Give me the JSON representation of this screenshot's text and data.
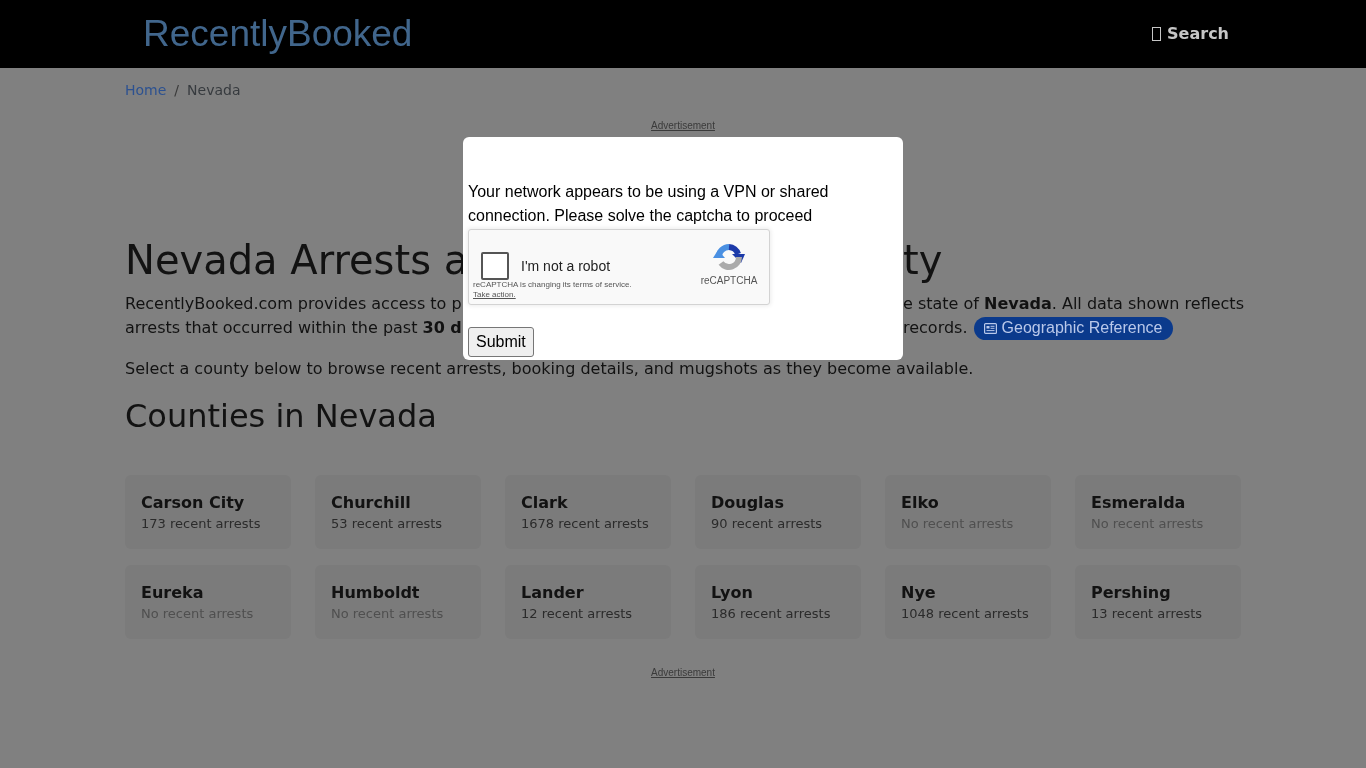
{
  "header": {
    "logo": "RecentlyBooked",
    "search_link": {
      "label": "Search"
    }
  },
  "breadcrumb": {
    "separator": "/",
    "items": [
      {
        "label": "Home",
        "current": false
      },
      {
        "label": "Nevada",
        "current": true
      }
    ]
  },
  "top_ad": {
    "label": "Advertisement"
  },
  "intro": {
    "heading": {
      "left": "Nevada Arrests a",
      "right": "ty"
    },
    "lines": [
      {
        "left": "RecentlyBooked.com provides access to p",
        "right": "e state of **Nevada**. All data shown reflects"
      },
      {
        "left": "arrests that occurred within the past **30 d**",
        "right": "records.",
        "badge": {
          "label": "Geographic Reference"
        }
      }
    ],
    "note": "Select a county below to browse recent arrests, booking details, and mugshots as they become available."
  },
  "counties_heading": "Counties in Nevada",
  "counties": [
    {
      "name": "Carson City",
      "arrests": "173 recent arrests",
      "muted": false
    },
    {
      "name": "Churchill",
      "arrests": "53 recent arrests",
      "muted": false
    },
    {
      "name": "Clark",
      "arrests": "1678 recent arrests",
      "muted": false
    },
    {
      "name": "Douglas",
      "arrests": "90 recent arrests",
      "muted": false
    },
    {
      "name": "Elko",
      "arrests": "No recent arrests",
      "muted": true
    },
    {
      "name": "Esmeralda",
      "arrests": "No recent arrests",
      "muted": true
    },
    {
      "name": "Eureka",
      "arrests": "No recent arrests",
      "muted": true
    },
    {
      "name": "Humboldt",
      "arrests": "No recent arrests",
      "muted": true
    },
    {
      "name": "Lander",
      "arrests": "12 recent arrests",
      "muted": false
    },
    {
      "name": "Lyon",
      "arrests": "186 recent arrests",
      "muted": false
    },
    {
      "name": "Nye",
      "arrests": "1048 recent arrests",
      "muted": false
    },
    {
      "name": "Pershing",
      "arrests": "13 recent arrests",
      "muted": false
    }
  ],
  "bottom_ad": {
    "label": "Advertisement"
  },
  "captcha_modal": {
    "message": "Your network appears to be using a VPN or shared connection. Please solve the captcha to proceed",
    "recaptcha": {
      "label": "I'm not a robot",
      "checked": false,
      "notice": "reCAPTCHA is changing its terms of service.",
      "notice_link": "Take action.",
      "brand": "reCAPTCHA"
    },
    "submit": "Submit"
  }
}
